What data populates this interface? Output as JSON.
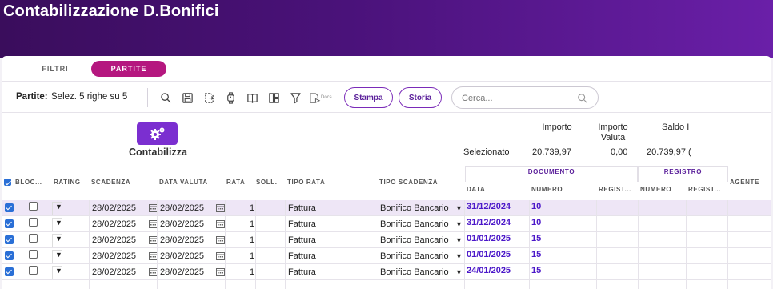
{
  "app": {
    "title": "Contabilizzazione D.Bonifici"
  },
  "tabs": [
    {
      "label": "FILTRI",
      "active": false
    },
    {
      "label": "PARTITE",
      "active": true
    }
  ],
  "toolbar": {
    "label": "Partite:",
    "selection": "Selez. 5 righe su 5",
    "docs_label": "Docs",
    "stampa_label": "Stampa",
    "storia_label": "Storia",
    "icons": [
      "search-icon",
      "save-icon",
      "export-icon",
      "watch-icon",
      "book-icon",
      "columns-icon",
      "filter-icon",
      "docs-send-icon"
    ]
  },
  "search": {
    "placeholder": "Cerca..."
  },
  "contabilizza": {
    "label": "Contabilizza",
    "icon": "gears-icon"
  },
  "summary": {
    "headers": {
      "importo": "Importo",
      "importo_valuta_1": "Importo",
      "importo_valuta_2": "Valuta",
      "saldo": "Saldo I"
    },
    "label": "Selezionato",
    "importo": "20.739,97",
    "importo_valuta": "0,00",
    "saldo": "20.739,97 ("
  },
  "groups": {
    "documento": "DOCUMENTO",
    "registro": "REGISTRO"
  },
  "columns": {
    "bloc": "BLOC...",
    "rating": "RATING",
    "scadenza": "SCADENZA",
    "data_valuta": "DATA VALUTA",
    "rata": "RATA",
    "soll": "SOLL.",
    "tipo_rata": "TIPO RATA",
    "tipo_scadenza": "TIPO SCADENZA",
    "doc_data": "DATA",
    "doc_numero": "NUMERO",
    "doc_registro": "REGIST...",
    "reg_numero": "NUMERO",
    "reg_registro": "REGIST...",
    "agente": "AGENTE"
  },
  "rows": [
    {
      "checked": true,
      "blocked": false,
      "rating": "▼",
      "scadenza": "28/02/2025",
      "data_valuta": "28/02/2025",
      "rata": "1",
      "tipo_rata": "Fattura",
      "tipo_scadenza": "Bonifico Bancario",
      "doc_data": "31/12/2024",
      "doc_numero": "10"
    },
    {
      "checked": true,
      "blocked": false,
      "rating": "▼",
      "scadenza": "28/02/2025",
      "data_valuta": "28/02/2025",
      "rata": "1",
      "tipo_rata": "Fattura",
      "tipo_scadenza": "Bonifico Bancario",
      "doc_data": "31/12/2024",
      "doc_numero": "10"
    },
    {
      "checked": true,
      "blocked": false,
      "rating": "▼",
      "scadenza": "28/02/2025",
      "data_valuta": "28/02/2025",
      "rata": "1",
      "tipo_rata": "Fattura",
      "tipo_scadenza": "Bonifico Bancario",
      "doc_data": "01/01/2025",
      "doc_numero": "15"
    },
    {
      "checked": true,
      "blocked": false,
      "rating": "▼",
      "scadenza": "28/02/2025",
      "data_valuta": "28/02/2025",
      "rata": "1",
      "tipo_rata": "Fattura",
      "tipo_scadenza": "Bonifico Bancario",
      "doc_data": "01/01/2025",
      "doc_numero": "15"
    },
    {
      "checked": true,
      "blocked": false,
      "rating": "▼",
      "scadenza": "28/02/2025",
      "data_valuta": "28/02/2025",
      "rata": "1",
      "tipo_rata": "Fattura",
      "tipo_scadenza": "Bonifico Bancario",
      "doc_data": "24/01/2025",
      "doc_numero": "15"
    }
  ],
  "colors": {
    "header_gradient_start": "#3a0d5c",
    "header_gradient_end": "#6a1fa8",
    "tab_active": "#b5177f",
    "accent": "#7b2fd0",
    "link": "#4b17c9",
    "row_selected": "#eee6f6",
    "checkbox": "#2a6fd6"
  }
}
